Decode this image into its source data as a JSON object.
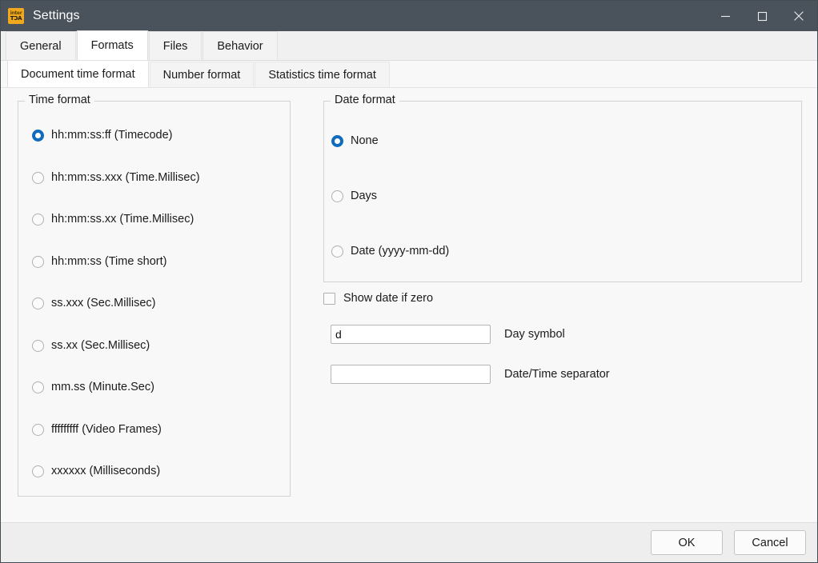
{
  "window": {
    "title": "Settings",
    "app_icon": "interact-app-icon",
    "icon_line1": "inter",
    "icon_line2": "ACT",
    "accent_color": "#0f6cbd",
    "titlebar_color": "#4a535b",
    "icon_color": "#f0a81e",
    "controls": [
      {
        "name": "minimize-button",
        "glyph": "minimize"
      },
      {
        "name": "maximize-button",
        "glyph": "maximize"
      },
      {
        "name": "close-button",
        "glyph": "close"
      }
    ]
  },
  "tabs": [
    {
      "label": "General",
      "active": false
    },
    {
      "label": "Formats",
      "active": true
    },
    {
      "label": "Files",
      "active": false
    },
    {
      "label": "Behavior",
      "active": false
    }
  ],
  "subtabs": [
    {
      "label": "Document time format",
      "active": true
    },
    {
      "label": "Number format",
      "active": false
    },
    {
      "label": "Statistics time format",
      "active": false
    }
  ],
  "time_format": {
    "legend": "Time format",
    "selected_index": 0,
    "options": [
      {
        "label": "hh:mm:ss:ff (Timecode)",
        "checked": true
      },
      {
        "label": "hh:mm:ss.xxx (Time.Millisec)",
        "checked": false
      },
      {
        "label": "hh:mm:ss.xx (Time.Millisec)",
        "checked": false
      },
      {
        "label": "hh:mm:ss (Time short)",
        "checked": false
      },
      {
        "label": "ss.xxx (Sec.Millisec)",
        "checked": false
      },
      {
        "label": "ss.xx (Sec.Millisec)",
        "checked": false
      },
      {
        "label": "mm.ss (Minute.Sec)",
        "checked": false
      },
      {
        "label": "fffffffff (Video Frames)",
        "checked": false
      },
      {
        "label": "xxxxxx (Milliseconds)",
        "checked": false
      }
    ]
  },
  "date_format": {
    "legend": "Date format",
    "selected_index": 0,
    "options": [
      {
        "label": "None",
        "checked": true
      },
      {
        "label": "Days",
        "checked": false
      },
      {
        "label": "Date (yyyy-mm-dd)",
        "checked": false
      }
    ]
  },
  "show_date_if_zero": {
    "label": "Show date if zero",
    "checked": false
  },
  "fields": [
    {
      "label": "Day symbol",
      "value": "d",
      "placeholder": ""
    },
    {
      "label": "Date/Time separator",
      "value": "",
      "placeholder": ""
    }
  ],
  "footer": {
    "ok_label": "OK",
    "cancel_label": "Cancel"
  }
}
